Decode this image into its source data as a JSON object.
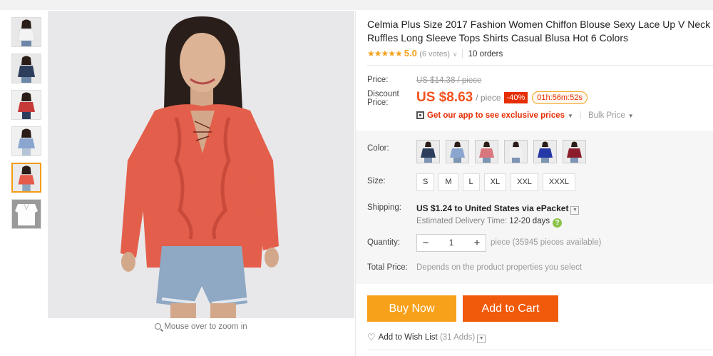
{
  "product": {
    "title": "Celmia Plus Size 2017 Fashion Women Chiffon Blouse Sexy Lace Up V Neck Ruffles Long Sleeve Tops Shirts Casual Blusa Hot 6 Colors",
    "stars": "★★★★★",
    "rating": "5.0",
    "votes": "(6 votes)",
    "orders": "10 orders"
  },
  "labels": {
    "price": "Price:",
    "discount_price": "Discount Price:",
    "color": "Color:",
    "size": "Size:",
    "shipping": "Shipping:",
    "quantity": "Quantity:",
    "total_price": "Total Price:"
  },
  "pricing": {
    "original": "US $14.38 / piece",
    "discount": "US $8.63",
    "per": "/ piece",
    "off": "-40%",
    "countdown": "01h:56m:52s",
    "app_promo": "Get our app to see exclusive prices",
    "bulk": "Bulk Price"
  },
  "colors": [
    "#2d3e5c",
    "#8aa6cf",
    "#d8777d",
    "#f1f1f1",
    "#2438a6",
    "#8a1c2c"
  ],
  "sizes": [
    "S",
    "M",
    "L",
    "XL",
    "XXL",
    "XXXL"
  ],
  "shipping": {
    "cost": "US $1.24",
    "dest": " to United States via ePacket",
    "eta_label": "Estimated Delivery Time:",
    "eta_days": "12-20 days"
  },
  "quantity": {
    "value": "1",
    "note": "piece (35945 pieces available)"
  },
  "total_note": "Depends on the product properties you select",
  "buttons": {
    "buy_now": "Buy Now",
    "add_to_cart": "Add to Cart"
  },
  "wishlist": {
    "label": "Add to Wish List",
    "count": "(31 Adds)"
  },
  "zoom_hint": "Mouse over to zoom in",
  "thumbnails": [
    {
      "color": "#f3f3f3",
      "name": "white"
    },
    {
      "color": "#2d3e5c",
      "name": "navy"
    },
    {
      "color": "#c73a3a",
      "name": "red"
    },
    {
      "color": "#8aa6cf",
      "name": "light-blue"
    },
    {
      "color": "#e55b4b",
      "name": "orange-red"
    },
    {
      "color": "#ffffff",
      "name": "white-flat"
    }
  ],
  "accent": {
    "orange": "#f4511e",
    "buy": "#f7a11b",
    "cart": "#f05a0a",
    "star": "#f4a11b"
  }
}
